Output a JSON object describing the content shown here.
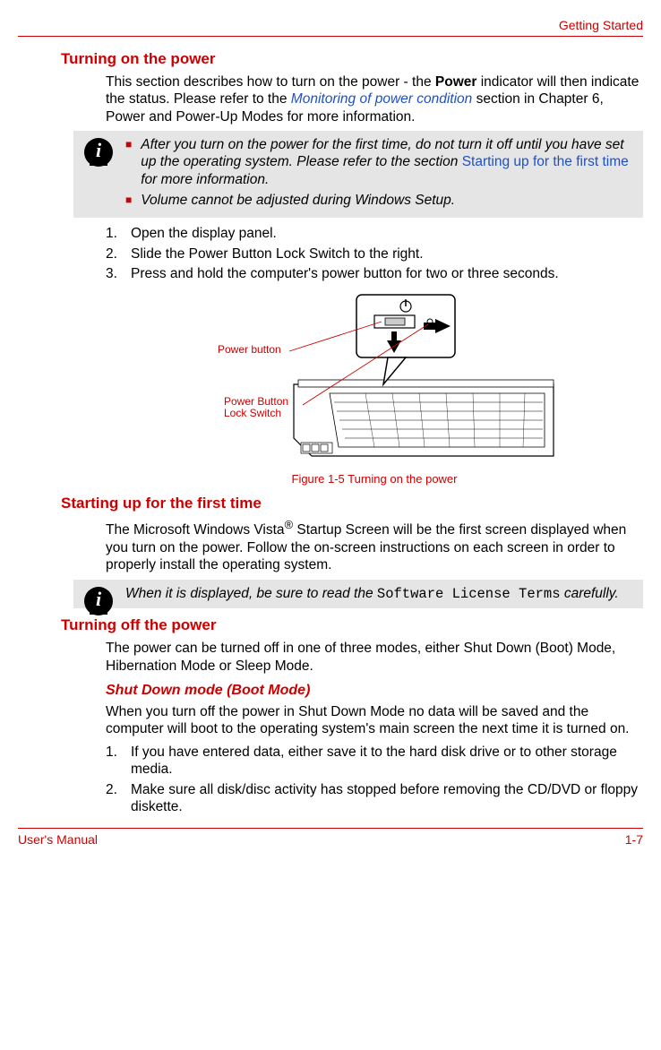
{
  "header": {
    "section": "Getting Started"
  },
  "s1": {
    "title": "Turning on the power",
    "p1a": "This section describes how to turn on the power - the ",
    "p1b": "Power",
    "p1c": " indicator will then indicate the status. Please refer to the ",
    "p1d": "Monitoring of power condition",
    "p1e": " section in Chapter 6, Power and Power-Up Modes for more information."
  },
  "note1": {
    "iconChar": "i",
    "b1a": "After you turn on the power for the first time, do not turn it off until you have set up the operating system. Please refer to the section ",
    "b1b": "Starting up for the first time",
    "b1c": " for more information.",
    "b2": "Volume cannot be adjusted during Windows Setup."
  },
  "steps1": {
    "i1": "Open the display panel.",
    "i2": "Slide the Power Button Lock Switch to the right.",
    "i3": "Press and hold the computer's power button for two or three seconds."
  },
  "figure": {
    "label1": "Power button",
    "label2a": "Power Button",
    "label2b": "Lock Switch",
    "caption": "Figure 1-5 Turning on the power"
  },
  "s2": {
    "title": "Starting up for the first time",
    "p1a": "The Microsoft Windows Vista",
    "p1sup": "®",
    "p1b": " Startup Screen will be the first screen displayed when you turn on the power. Follow the on-screen instructions on each screen in order to properly install the operating system."
  },
  "note2": {
    "iconChar": "i",
    "t1": "When it is displayed, be sure to read the ",
    "t2": "Software License Terms",
    "t3": " carefully."
  },
  "s3": {
    "title": "Turning off the power",
    "p1": "The power can be turned off in one of three modes, either Shut Down (Boot) Mode, Hibernation Mode or Sleep Mode."
  },
  "s3a": {
    "title": "Shut Down mode (Boot Mode)",
    "p1": "When you turn off the power in Shut Down Mode no data will be saved and the computer will boot to the operating system's main screen the next time it is turned on.",
    "i1": "If you have entered data, either save it to the hard disk drive or to other storage media.",
    "i2": "Make sure all disk/disc activity has stopped before removing the CD/DVD or floppy diskette."
  },
  "footer": {
    "left": "User's Manual",
    "right": "1-7"
  }
}
